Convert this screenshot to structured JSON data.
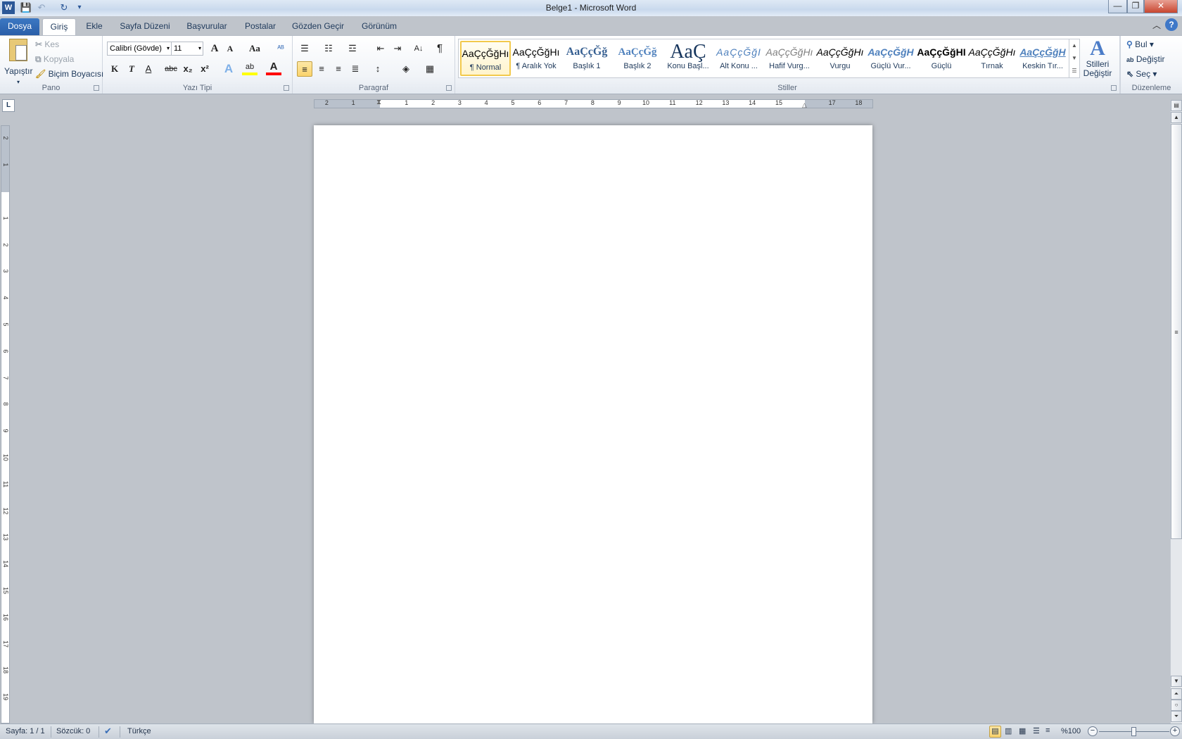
{
  "window": {
    "title": "Belge1  -  Microsoft Word",
    "app_icon": "W",
    "minimize": "—",
    "restore": "❐",
    "close": "✕"
  },
  "qat": {
    "save": "save-icon",
    "undo": "undo-icon",
    "redo": "redo-icon",
    "customize": "customize-icon"
  },
  "tabs": [
    {
      "label": "Dosya"
    },
    {
      "label": "Giriş"
    },
    {
      "label": "Ekle"
    },
    {
      "label": "Sayfa Düzeni"
    },
    {
      "label": "Başvurular"
    },
    {
      "label": "Postalar"
    },
    {
      "label": "Gözden Geçir"
    },
    {
      "label": "Görünüm"
    }
  ],
  "ribbon": {
    "pano": {
      "label": "Pano",
      "paste": "Yapıştır",
      "cut": "Kes",
      "copy": "Kopyala",
      "format_painter": "Biçim Boyacısı"
    },
    "font": {
      "label": "Yazı Tipi",
      "font_name": "Calibri (Gövde)",
      "font_size": "11",
      "bold": "K",
      "italic": "T",
      "underline": "A",
      "strike": "abc",
      "sub": "x₂",
      "sup": "x²",
      "case": "Aa",
      "grow": "A",
      "shrink": "A",
      "effects": "A",
      "highlight": "ab",
      "color": "A"
    },
    "paragraph": {
      "label": "Paragraf",
      "pilcrow": "¶",
      "sort": "A↓"
    },
    "styles": {
      "label": "Stiller",
      "change_styles": "Stilleri Değiştir",
      "items": [
        {
          "preview": "AaÇçĞğHı",
          "name": "¶ Normal",
          "selected": true
        },
        {
          "preview": "AaÇçĞğHı",
          "name": "¶ Aralık Yok"
        },
        {
          "preview": "AaÇçĞğ",
          "name": "Başlık 1"
        },
        {
          "preview": "AaÇçĞğ",
          "name": "Başlık 2"
        },
        {
          "preview": "AaÇ",
          "name": "Konu Başl..."
        },
        {
          "preview": "AaÇçĞğI",
          "name": "Alt Konu ..."
        },
        {
          "preview": "AaÇçĞğHı",
          "name": "Hafif Vurg..."
        },
        {
          "preview": "AaÇçĞğHı",
          "name": "Vurgu"
        },
        {
          "preview": "AaÇçĞğH",
          "name": "Güçlü Vur..."
        },
        {
          "preview": "AaÇçĞğHI",
          "name": "Güçlü"
        },
        {
          "preview": "AaÇçĞğHı",
          "name": "Tırnak"
        },
        {
          "preview": "AaÇçĞğH",
          "name": "Keskin Tır..."
        }
      ]
    },
    "editing": {
      "label": "Düzenleme",
      "find": "Bul",
      "replace": "Değiştir",
      "select": "Seç"
    }
  },
  "ruler": {
    "h_left": [
      "2",
      "1"
    ],
    "h_right": [
      "1",
      "2",
      "3",
      "4",
      "5",
      "6",
      "7",
      "8",
      "9",
      "10",
      "11",
      "12",
      "13",
      "14",
      "15",
      "17",
      "18"
    ],
    "v_top": [
      "2",
      "1"
    ],
    "v_main": [
      "1",
      "2",
      "3",
      "4",
      "5",
      "6",
      "7",
      "8",
      "9",
      "10",
      "11",
      "12",
      "13",
      "14",
      "15",
      "16",
      "17",
      "18",
      "19"
    ]
  },
  "status": {
    "page": "Sayfa: 1 / 1",
    "words": "Sözcük: 0",
    "language": "Türkçe",
    "zoom": "%100",
    "zoom_percent": 100
  },
  "colors": {
    "accent": "#2a5ea8",
    "highlight": "#ffff00",
    "font_color": "#ff0000"
  }
}
